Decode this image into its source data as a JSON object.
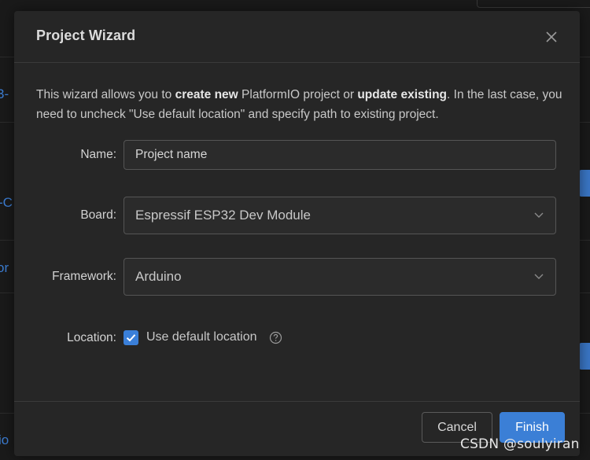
{
  "background": {
    "fragments": [
      "3-",
      "-C",
      "or",
      "io"
    ]
  },
  "dialog": {
    "title": "Project Wizard",
    "close_icon": "close-icon",
    "intro": {
      "part1": "This wizard allows you to ",
      "bold1": "create new",
      "part2": " PlatformIO project or ",
      "bold2": "update existing",
      "part3": ". In the last case, you need to uncheck \"Use default location\" and specify path to existing project."
    },
    "name": {
      "label": "Name:",
      "placeholder": "Project name",
      "value": ""
    },
    "board": {
      "label": "Board:",
      "selected": "Espressif ESP32 Dev Module"
    },
    "framework": {
      "label": "Framework:",
      "selected": "Arduino"
    },
    "location": {
      "label": "Location:",
      "checkbox_label": "Use default location",
      "checked": true,
      "help_icon": "question-circle-icon"
    },
    "buttons": {
      "cancel": "Cancel",
      "finish": "Finish"
    }
  },
  "watermark": "CSDN @soulyiran",
  "colors": {
    "accent": "#3b7fd6",
    "dialog_bg": "#262626",
    "page_bg": "#1a1a1a"
  }
}
